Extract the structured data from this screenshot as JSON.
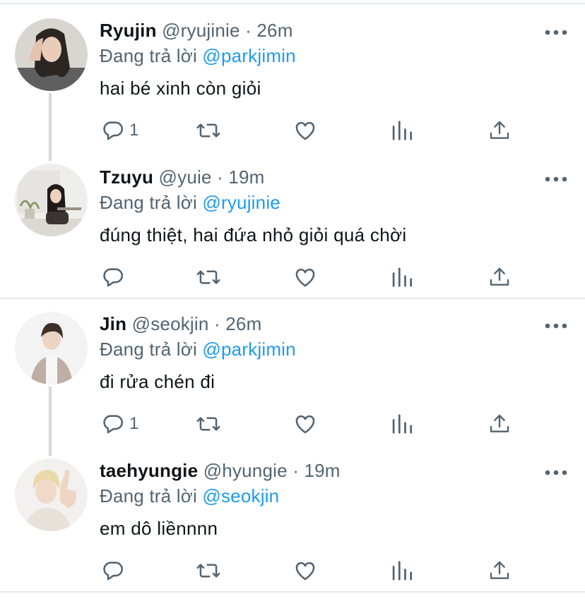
{
  "tweets": [
    {
      "name": "Ryujin",
      "handle": "@ryujinie",
      "time": "· 26m",
      "replying_prefix": "Đang trả lời",
      "replying_to": "@parkjimin",
      "text": "hai bé xinh còn giỏi",
      "reply_count": "1"
    },
    {
      "name": "Tzuyu",
      "handle": "@yuie",
      "time": "· 19m",
      "replying_prefix": "Đang trả lời",
      "replying_to": "@ryujinie",
      "text": "đúng thiệt, hai đứa nhỏ giỏi quá chời",
      "reply_count": ""
    },
    {
      "name": "Jin",
      "handle": "@seokjin",
      "time": "· 26m",
      "replying_prefix": "Đang trả lời",
      "replying_to": "@parkjimin",
      "text": "đi rửa chén đi",
      "reply_count": "1"
    },
    {
      "name": "taehyungie",
      "handle": "@hyungie",
      "time": "· 19m",
      "replying_prefix": "Đang trả lời",
      "replying_to": "@seokjin",
      "text": "em dô liềnnnn",
      "reply_count": ""
    }
  ],
  "icons": {
    "more": "more-horizontal-icon",
    "reply": "reply-bubble-icon",
    "retweet": "retweet-icon",
    "like": "heart-icon",
    "analytics": "analytics-bars-icon",
    "share": "share-upload-icon"
  },
  "colors": {
    "text": "#0f1419",
    "secondary": "#536471",
    "mention": "#1d9bf0",
    "divider": "#e6e9eb",
    "thread_line": "#cfd9de"
  }
}
